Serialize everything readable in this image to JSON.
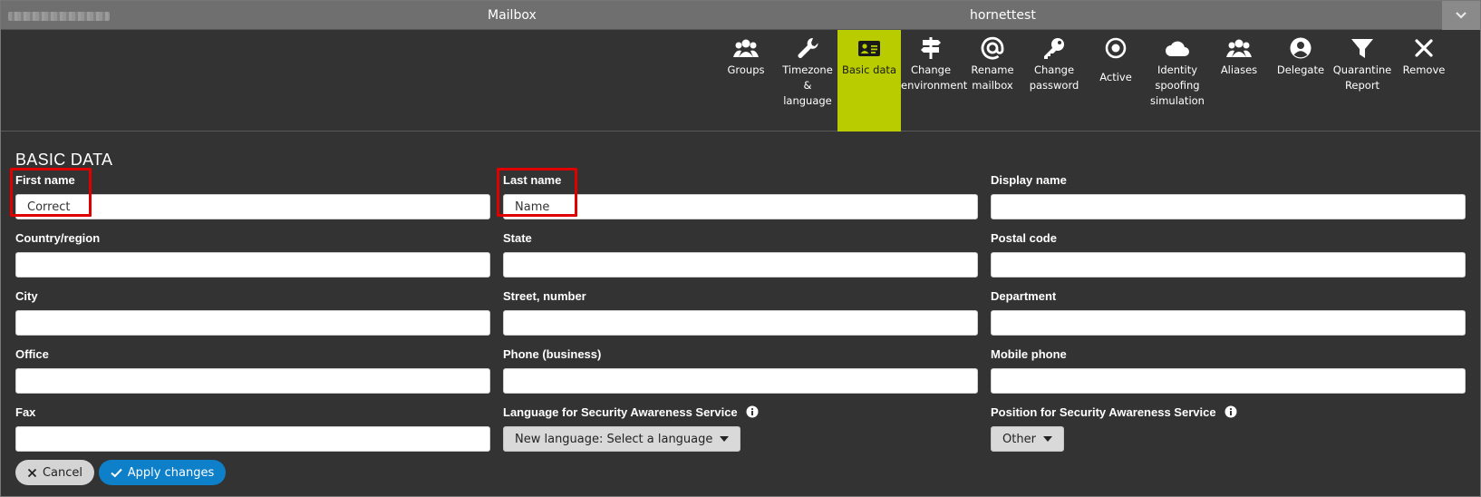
{
  "titlebar": {
    "title": "Mailbox",
    "account": "hornettest",
    "collapse_icon": "chevron-down-icon"
  },
  "toolbar": {
    "active_color": "#b9cc00",
    "items": [
      {
        "id": "groups",
        "label": "Groups",
        "icon": "users-icon"
      },
      {
        "id": "timezone",
        "label": "Timezone & language",
        "icon": "wrench-icon"
      },
      {
        "id": "basic",
        "label": "Basic data",
        "icon": "id-card-icon",
        "active": true
      },
      {
        "id": "environment",
        "label": "Change environment",
        "icon": "signpost-icon"
      },
      {
        "id": "rename",
        "label": "Rename mailbox",
        "icon": "at-icon"
      },
      {
        "id": "password",
        "label": "Change password",
        "icon": "key-icon"
      },
      {
        "id": "active",
        "label": "Active",
        "icon": "radio-on-icon"
      },
      {
        "id": "spoofing",
        "label": "Identity spoofing simulation",
        "icon": "cloud-icon"
      },
      {
        "id": "aliases",
        "label": "Aliases",
        "icon": "users-icon"
      },
      {
        "id": "delegate",
        "label": "Delegate",
        "icon": "user-circle-icon"
      },
      {
        "id": "quarantine",
        "label": "Quarantine Report",
        "icon": "filter-icon"
      },
      {
        "id": "remove",
        "label": "Remove",
        "icon": "close-icon"
      }
    ]
  },
  "form": {
    "section_title": "BASIC DATA",
    "fields": {
      "first_name": {
        "label": "First name",
        "value": "Correct"
      },
      "last_name": {
        "label": "Last name",
        "value": "Name"
      },
      "display_name": {
        "label": "Display name",
        "value": ""
      },
      "country": {
        "label": "Country/region",
        "value": ""
      },
      "state": {
        "label": "State",
        "value": ""
      },
      "postal_code": {
        "label": "Postal code",
        "value": ""
      },
      "city": {
        "label": "City",
        "value": ""
      },
      "street": {
        "label": "Street, number",
        "value": ""
      },
      "department": {
        "label": "Department",
        "value": ""
      },
      "office": {
        "label": "Office",
        "value": ""
      },
      "phone_business": {
        "label": "Phone (business)",
        "value": ""
      },
      "mobile_phone": {
        "label": "Mobile phone",
        "value": ""
      },
      "fax": {
        "label": "Fax",
        "value": ""
      }
    },
    "sas_language": {
      "label": "Language for Security Awareness Service",
      "selected": "New language: Select a language"
    },
    "sas_position": {
      "label": "Position for Security Awareness Service",
      "selected": "Other"
    }
  },
  "actions": {
    "cancel_label": "Cancel",
    "apply_label": "Apply changes",
    "apply_color": "#0d80c9"
  },
  "highlight_color": "#e00000"
}
